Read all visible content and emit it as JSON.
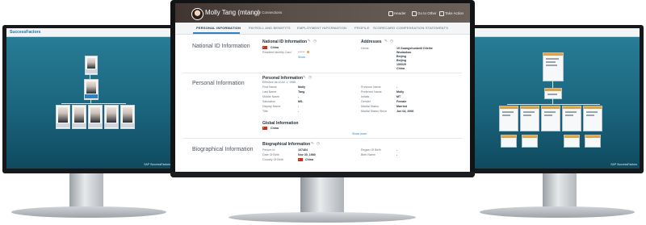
{
  "profile": {
    "user_name": "Molly Tang (mtang)",
    "subtitle": "... 12 Connections",
    "header_actions": [
      "Header",
      "Go to Other",
      "Take Action"
    ]
  },
  "tabs": [
    "PERSONAL INFORMATION",
    "PAYROLL AND BENEFITS",
    "EMPLOYMENT INFORMATION",
    "PROFILE",
    "SCORECARD",
    "COMPENSATION STATEMENTS"
  ],
  "sections": {
    "national_id": {
      "section_title": "National ID Information",
      "block_title": "National ID Information",
      "country": "China",
      "field_label": "Resident Identity Card",
      "field_value": "******",
      "show_more": "Show"
    },
    "addresses": {
      "block_title": "Addresses",
      "type_label": "Home",
      "lines": [
        "15 Guangshunbeili Dileihe",
        "Wudaokou",
        "Beijing",
        "Beijing",
        "100029",
        "China"
      ]
    },
    "personal": {
      "section_title": "Personal Information",
      "block_title": "Personal Information",
      "effective": "Effective as of Jul 1, 1986",
      "left_fields": [
        {
          "label": "First Name",
          "value": "Molly"
        },
        {
          "label": "Last Name",
          "value": "Tang"
        },
        {
          "label": "Middle Name",
          "value": "-"
        },
        {
          "label": "Salutation",
          "value": "MS."
        },
        {
          "label": "Display Name",
          "value": "-"
        },
        {
          "label": "Title",
          "value": "-"
        }
      ],
      "right_fields": [
        {
          "label": "Previous Name",
          "value": "-"
        },
        {
          "label": "Preferred Name",
          "value": "Molly"
        },
        {
          "label": "Initials",
          "value": "MT"
        },
        {
          "label": "Gender",
          "value": "Female"
        },
        {
          "label": "Marital Status",
          "value": "Married"
        },
        {
          "label": "Marital Status Since",
          "value": "Jun 04, 2006"
        }
      ],
      "global_title": "Global Information",
      "global_country": "China",
      "show_more": "Show more"
    },
    "biographical": {
      "section_title": "Biographical Information",
      "block_title": "Biographical Information",
      "left_fields": [
        {
          "label": "Person Id",
          "value": "107464"
        },
        {
          "label": "Date Of Birth",
          "value": "Nov 30, 1980"
        },
        {
          "label": "Country Of Birth",
          "value": "China"
        }
      ],
      "right_fields": [
        {
          "label": "Region Of Birth",
          "value": "-"
        },
        {
          "label": "Birth Name",
          "value": "-"
        }
      ]
    }
  },
  "left_monitor": {
    "logo": "SuccessFactors",
    "footer": "SAP SuccessFactors"
  },
  "right_monitor": {
    "footer": "SAP SuccessFactors"
  },
  "colors": {
    "accent": "#2f7fc2",
    "header": "#4c403a",
    "flag": "#d8281c",
    "side_bg": "#1f6f88"
  }
}
